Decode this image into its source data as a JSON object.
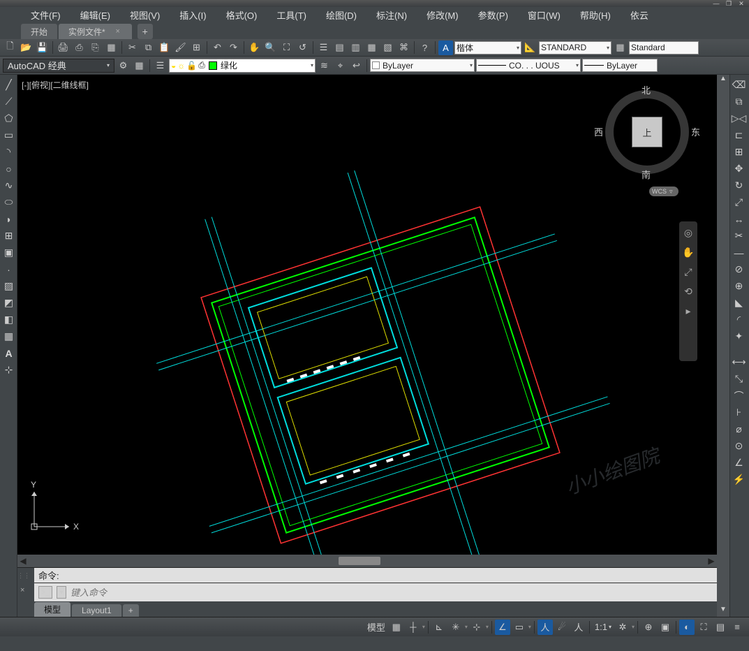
{
  "window": {
    "min": "—",
    "max": "❐",
    "close": "✕"
  },
  "menu": {
    "items": [
      "文件(F)",
      "编辑(E)",
      "视图(V)",
      "插入(I)",
      "格式(O)",
      "工具(T)",
      "绘图(D)",
      "标注(N)",
      "修改(M)",
      "参数(P)",
      "窗口(W)",
      "帮助(H)",
      "依云"
    ]
  },
  "tabs": {
    "start": "开始",
    "file": "实例文件*",
    "close": "×",
    "add": "+"
  },
  "toolbar1": {
    "font_select": "楷体",
    "text_style": "STANDARD",
    "dim_style": "Standard"
  },
  "toolbar2": {
    "workspace": "AutoCAD 经典",
    "layer": "绿化",
    "linecolor": "ByLayer",
    "linetype": "CO. . . UOUS",
    "lineweight": "ByLayer"
  },
  "viewport": {
    "label": "[-][俯视][二维线框]"
  },
  "viewcube": {
    "top": "上",
    "n": "北",
    "s": "南",
    "e": "东",
    "w": "西",
    "wcs": "WCS"
  },
  "ucs": {
    "x": "X",
    "y": "Y"
  },
  "watermark": "小小绘图院",
  "command": {
    "prompt": "命令:",
    "placeholder": "键入命令",
    "x": "×",
    "btn": ">_",
    "drop": "▾"
  },
  "layouts": {
    "model": "模型",
    "layout1": "Layout1",
    "add": "+"
  },
  "status": {
    "model": "模型",
    "ratio": "1:1",
    "dd": "▾"
  },
  "arrows": {
    "left": "◀",
    "right": "▶",
    "up": "▲",
    "down": "▼",
    "dd": "▾"
  }
}
